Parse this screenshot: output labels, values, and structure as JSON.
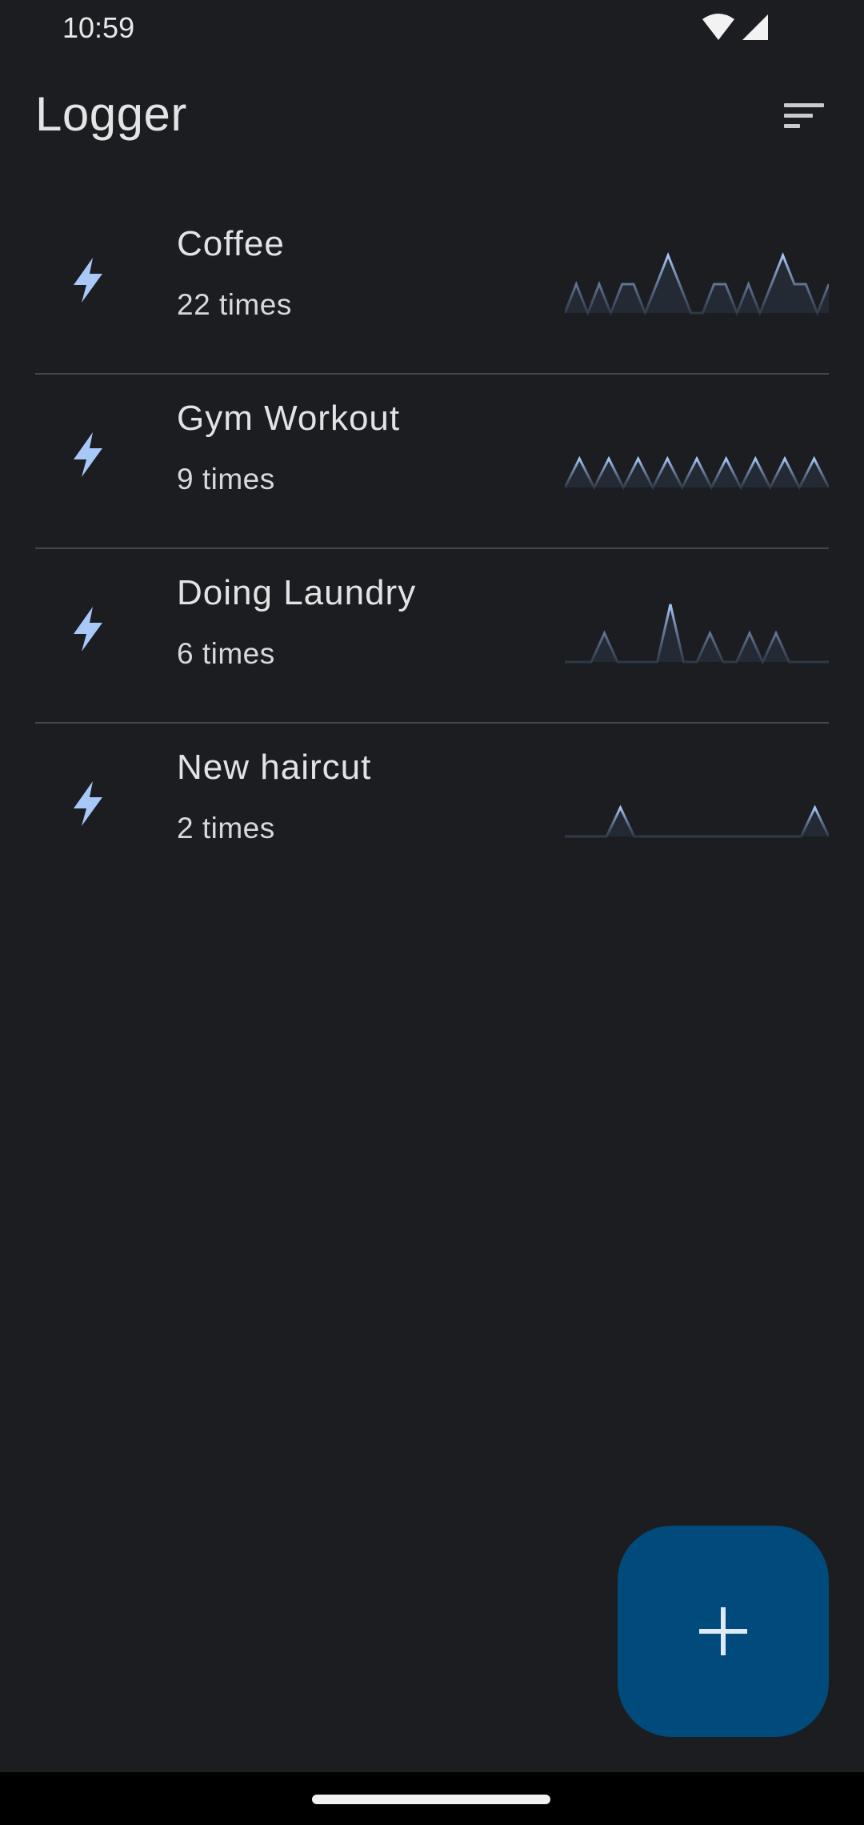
{
  "status_bar": {
    "time": "10:59",
    "icons": [
      "wifi-icon",
      "cellular-signal-icon"
    ]
  },
  "app_bar": {
    "title": "Logger",
    "sort_icon": "sort-icon"
  },
  "colors": {
    "background": "#1b1d20",
    "accent": "#a8c8f8",
    "fab": "#004a7c",
    "divider": "#43464b"
  },
  "items": [
    {
      "name": "Coffee",
      "count_label": "22 times",
      "icon": "bolt-icon",
      "trend": [
        0,
        1,
        0,
        1,
        0,
        1,
        1,
        0,
        1,
        2,
        1,
        0,
        0,
        1,
        1,
        0,
        1,
        0,
        1,
        2,
        1,
        1,
        0,
        1
      ]
    },
    {
      "name": "Gym Workout",
      "count_label": "9 times",
      "icon": "bolt-icon",
      "trend": [
        0,
        1,
        0,
        1,
        0,
        1,
        0,
        1,
        0,
        1,
        0,
        1,
        0,
        1,
        0,
        1,
        0,
        1,
        0
      ]
    },
    {
      "name": "Doing Laundry",
      "count_label": "6 times",
      "icon": "bolt-icon",
      "trend": [
        0,
        0,
        0,
        1,
        0,
        0,
        0,
        0,
        2,
        0,
        0,
        1,
        0,
        0,
        1,
        0,
        1,
        0,
        0,
        0,
        0
      ]
    },
    {
      "name": "New haircut",
      "count_label": "2 times",
      "icon": "bolt-icon",
      "trend": [
        0,
        0,
        0,
        0,
        1,
        0,
        0,
        0,
        0,
        0,
        0,
        0,
        0,
        0,
        0,
        0,
        0,
        0,
        1,
        0
      ]
    }
  ],
  "fab": {
    "icon": "plus-icon"
  }
}
